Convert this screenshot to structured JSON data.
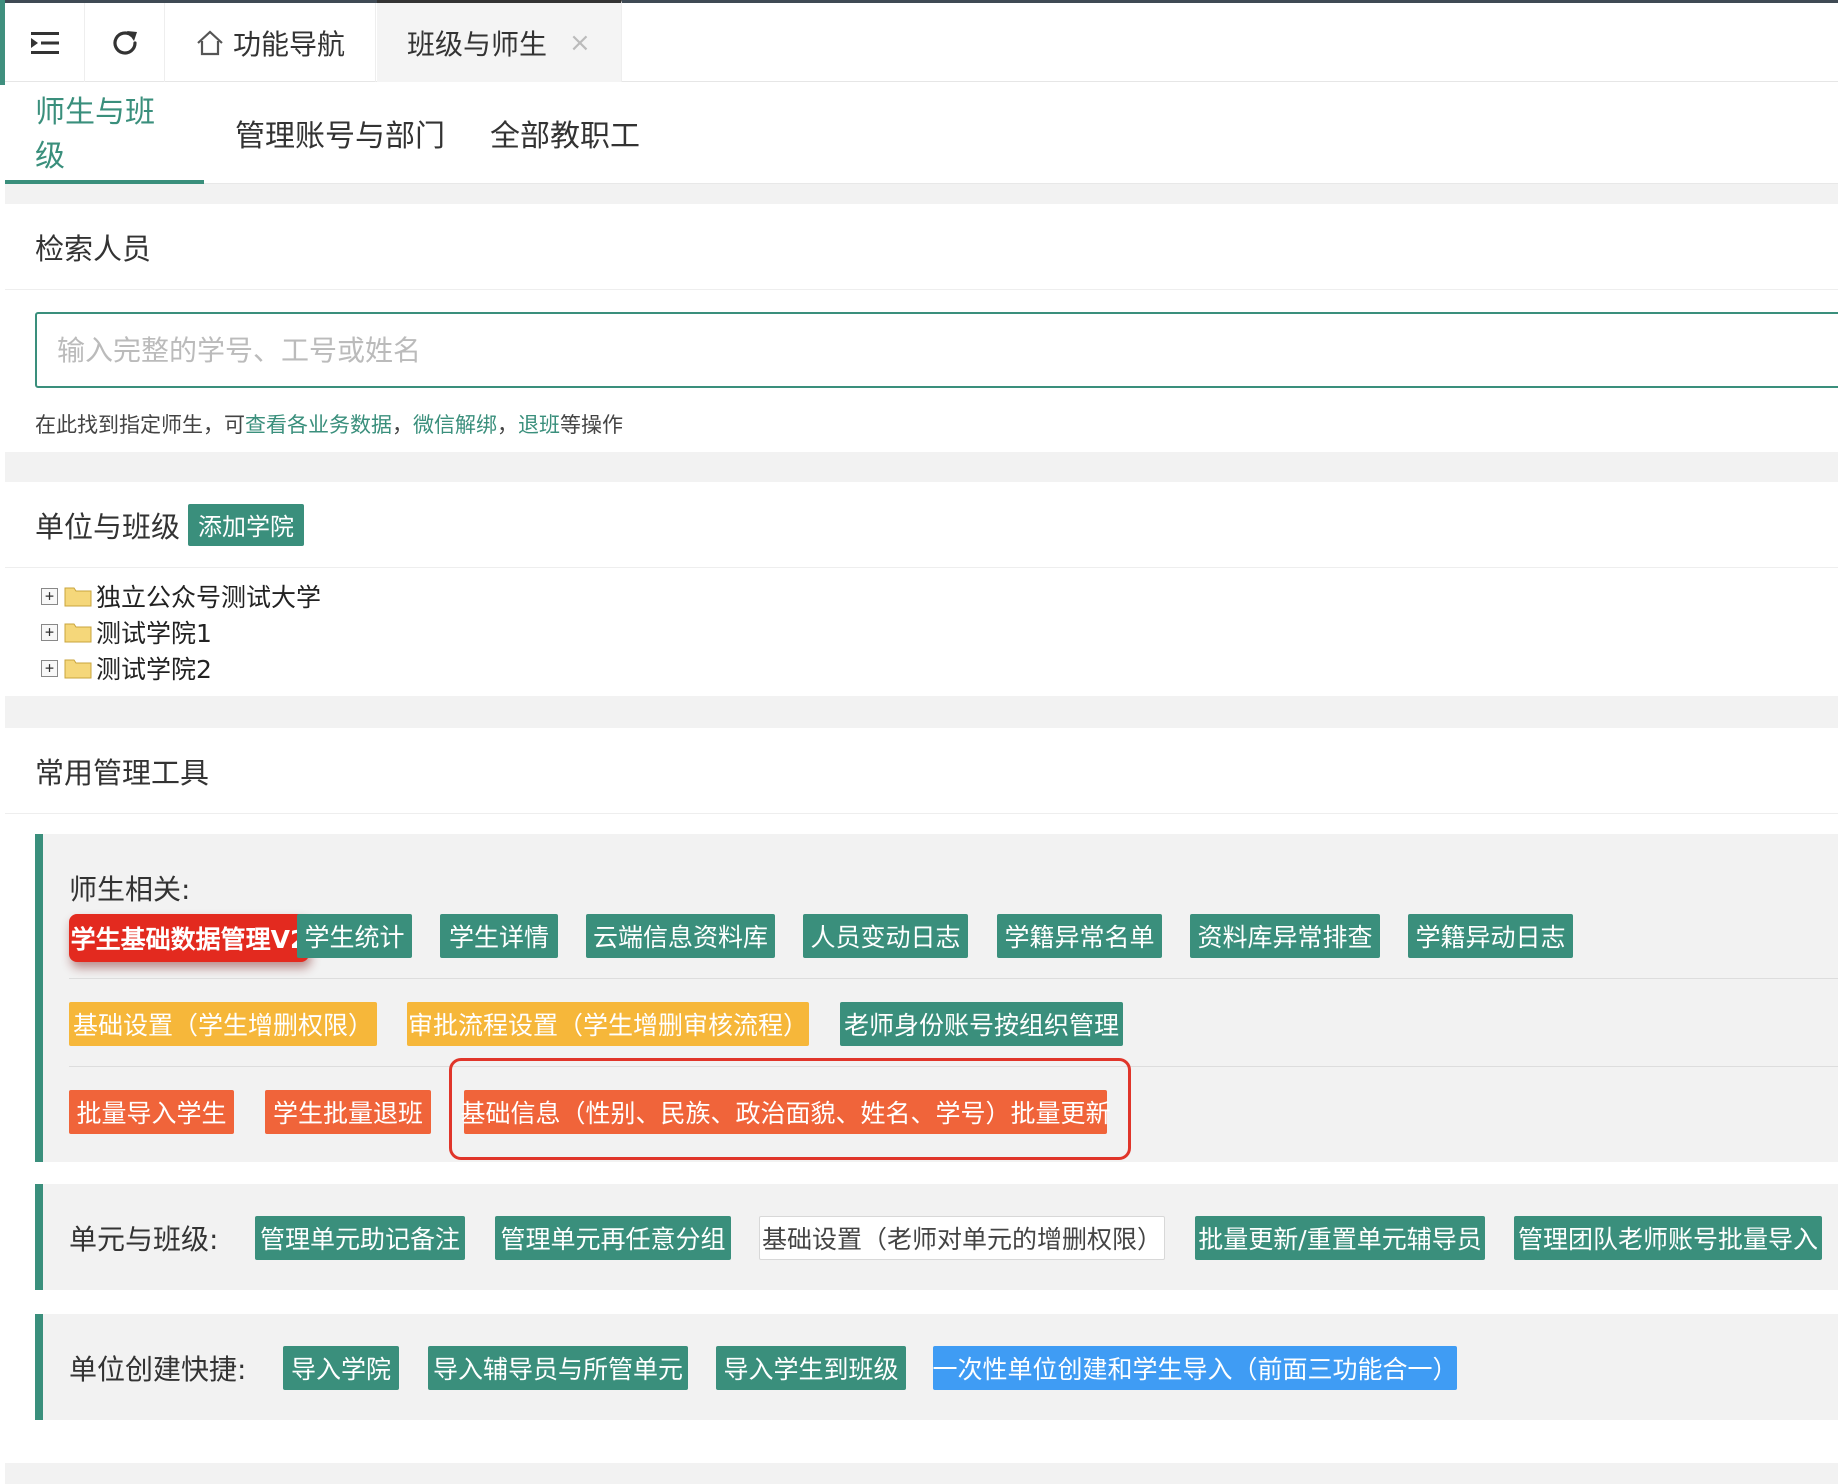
{
  "topbar": {
    "menu_icon": "menu-collapse-icon",
    "refresh_icon": "refresh-icon",
    "tabs": [
      {
        "label": "功能导航",
        "icon": "home-icon"
      },
      {
        "label": "班级与师生",
        "close": "×"
      }
    ]
  },
  "subnav": {
    "tabs": [
      "师生与班级",
      "管理账号与部门",
      "全部教职工"
    ]
  },
  "search": {
    "title": "检索人员",
    "placeholder": "输入完整的学号、工号或姓名",
    "hint_prefix": "在此找到指定师生，可",
    "hint_link1": "查看各业务数据",
    "hint_sep1": "，",
    "hint_link2": "微信解绑",
    "hint_sep2": "，",
    "hint_link3": "退班",
    "hint_suffix": "等操作"
  },
  "org": {
    "title": "单位与班级",
    "add_button": "添加学院",
    "tree": [
      {
        "label": "独立公众号测试大学",
        "expander": "+"
      },
      {
        "label": "测试学院1",
        "expander": "+"
      },
      {
        "label": "测试学院2",
        "expander": "+"
      }
    ]
  },
  "tools": {
    "title": "常用管理工具",
    "teacher_student": {
      "title": "师生相关:",
      "row1": [
        "学生基础数据管理V2",
        "学生统计",
        "学生详情",
        "云端信息资料库",
        "人员变动日志",
        "学籍异常名单",
        "资料库异常排查",
        "学籍异动日志"
      ],
      "row2": [
        "基础设置（学生增删权限）",
        "审批流程设置（学生增删审核流程）",
        "老师身份账号按组织管理"
      ],
      "row3": [
        "批量导入学生",
        "学生批量退班",
        "基础信息（性别、民族、政治面貌、姓名、学号）批量更新"
      ]
    },
    "unit_class": {
      "title": "单元与班级:",
      "buttons": [
        "管理单元助记备注",
        "管理单元再任意分组",
        "基础设置（老师对单元的增删权限）",
        "批量更新/重置单元辅导员",
        "管理团队老师账号批量导入"
      ]
    },
    "unit_create": {
      "title": "单位创建快捷:",
      "buttons": [
        "导入学院",
        "导入辅导员与所管单元",
        "导入学生到班级",
        "一次性单位创建和学生导入（前面三功能合一）"
      ]
    }
  },
  "colors": {
    "primary": "#3a8f7c",
    "warning": "#f6b73a",
    "danger": "#f0643a",
    "info": "#3f9cf4",
    "highlight": "#e32a1f"
  }
}
